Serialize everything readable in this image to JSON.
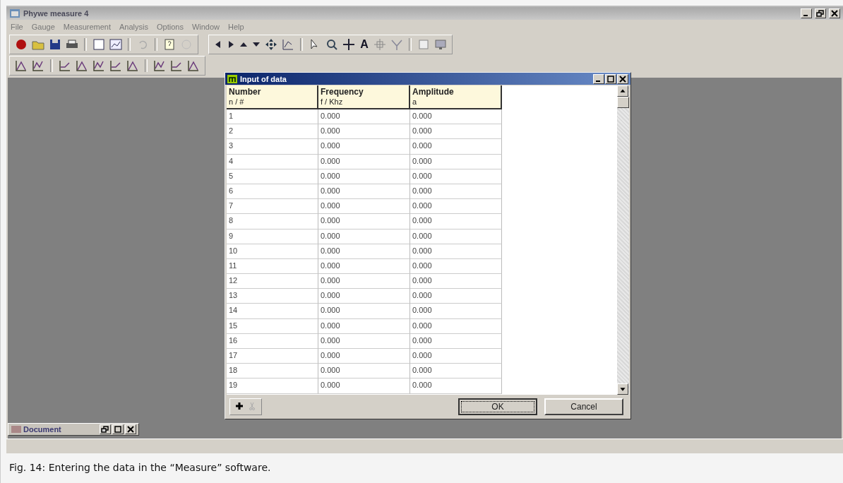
{
  "window": {
    "title": "Phywe measure 4",
    "active": false
  },
  "menu": [
    "File",
    "Gauge",
    "Measurement",
    "Analysis",
    "Options",
    "Window",
    "Help"
  ],
  "toolbar_text": "A",
  "dialog": {
    "title": "Input of data",
    "active": true,
    "columns": [
      {
        "name": "Number",
        "unit": "n / #"
      },
      {
        "name": "Frequency",
        "unit": "f / Khz"
      },
      {
        "name": "Amplitude",
        "unit": "a"
      }
    ],
    "rows": [
      [
        "1",
        "0.000",
        "0.000"
      ],
      [
        "2",
        "0.000",
        "0.000"
      ],
      [
        "3",
        "0.000",
        "0.000"
      ],
      [
        "4",
        "0.000",
        "0.000"
      ],
      [
        "5",
        "0.000",
        "0.000"
      ],
      [
        "6",
        "0.000",
        "0.000"
      ],
      [
        "7",
        "0.000",
        "0.000"
      ],
      [
        "8",
        "0.000",
        "0.000"
      ],
      [
        "9",
        "0.000",
        "0.000"
      ],
      [
        "10",
        "0.000",
        "0.000"
      ],
      [
        "11",
        "0.000",
        "0.000"
      ],
      [
        "12",
        "0.000",
        "0.000"
      ],
      [
        "13",
        "0.000",
        "0.000"
      ],
      [
        "14",
        "0.000",
        "0.000"
      ],
      [
        "15",
        "0.000",
        "0.000"
      ],
      [
        "16",
        "0.000",
        "0.000"
      ],
      [
        "17",
        "0.000",
        "0.000"
      ],
      [
        "18",
        "0.000",
        "0.000"
      ],
      [
        "19",
        "0.000",
        "0.000"
      ]
    ],
    "buttons": [
      {
        "label": "OK",
        "focused": true
      },
      {
        "label": "Cancel",
        "focused": false
      }
    ]
  },
  "minimized_window": {
    "title": "Document"
  },
  "caption": "Fig. 14: Entering the data in the “Measure” software."
}
